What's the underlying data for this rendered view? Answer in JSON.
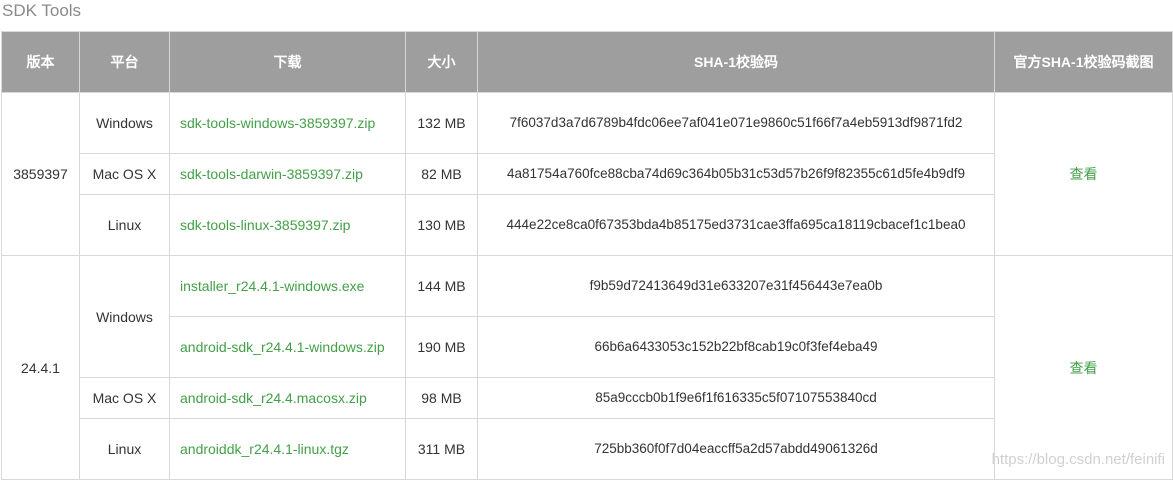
{
  "section_title": "SDK Tools",
  "headers": [
    "版本",
    "平台",
    "下载",
    "大小",
    "SHA-1校验码",
    "官方SHA-1校验码截图"
  ],
  "group1": {
    "version": "3859397",
    "view": "查看",
    "rows": [
      {
        "platform": "Windows",
        "file": "sdk-tools-windows-3859397.zip",
        "size": "132 MB",
        "sha": "7f6037d3a7d6789b4fdc06ee7af041e071e9860c51f66f7a4eb5913df9871fd2"
      },
      {
        "platform": "Mac OS X",
        "file": "sdk-tools-darwin-3859397.zip",
        "size": "82 MB",
        "sha": "4a81754a760fce88cba74d69c364b05b31c53d57b26f9f82355c61d5fe4b9df9"
      },
      {
        "platform": "Linux",
        "file": "sdk-tools-linux-3859397.zip",
        "size": "130 MB",
        "sha": "444e22ce8ca0f67353bda4b85175ed3731cae3ffa695ca18119cbacef1c1bea0"
      }
    ]
  },
  "group2": {
    "version": "24.4.1",
    "view": "查看",
    "windows_label": "Windows",
    "rows": [
      {
        "platform": "Windows",
        "file": "installer_r24.4.1-windows.exe",
        "size": "144 MB",
        "sha": "f9b59d72413649d31e633207e31f456443e7ea0b"
      },
      {
        "platform": "Windows",
        "file": "android-sdk_r24.4.1-windows.zip",
        "size": "190 MB",
        "sha": "66b6a6433053c152b22bf8cab19c0f3fef4eba49"
      },
      {
        "platform": "Mac OS X",
        "file": "android-sdk_r24.4.macosx.zip",
        "size": "98 MB",
        "sha": "85a9cccb0b1f9e6f1f616335c5f07107553840cd"
      },
      {
        "platform": "Linux",
        "file": "androiddk_r24.4.1-linux.tgz",
        "size": "311 MB",
        "sha": "725bb360f0f7d04eaccff5a2d57abdd49061326d"
      }
    ]
  },
  "watermark": "https://blog.csdn.net/feinifi",
  "colors": {
    "header_bg": "#9e9e9e",
    "link": "#43a047",
    "border": "#d8d8d8"
  }
}
